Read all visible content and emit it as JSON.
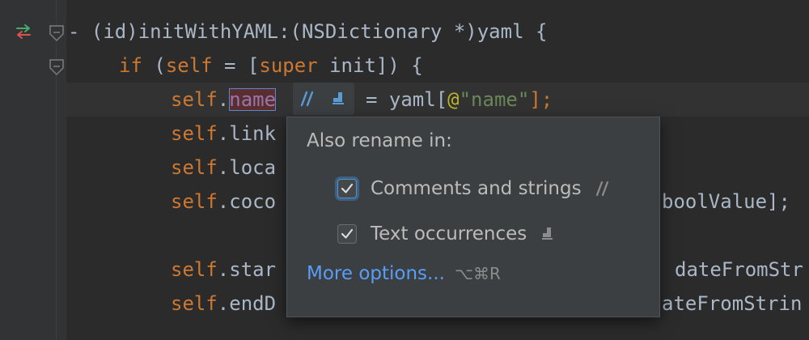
{
  "editor": {
    "lines": [
      {
        "id": "method-signature",
        "tokens": [
          {
            "t": "- (id)initWithYAML:(",
            "c": ""
          },
          {
            "t": "NSDictionary",
            "c": "cls"
          },
          {
            "t": " *)yaml {",
            "c": ""
          }
        ]
      },
      {
        "id": "if-line",
        "tokens": [
          {
            "t": "if",
            "c": "kw"
          },
          {
            "t": " (",
            "c": ""
          },
          {
            "t": "self",
            "c": "kw"
          },
          {
            "t": " = [",
            "c": ""
          },
          {
            "t": "super",
            "c": "kw"
          },
          {
            "t": " init]) {",
            "c": ""
          }
        ]
      },
      {
        "id": "name-line",
        "tokens": [
          {
            "t": "self",
            "c": "kw"
          },
          {
            "t": ".",
            "c": ""
          }
        ],
        "renamed": "name",
        "after": [
          {
            "t": "= yaml[",
            "c": ""
          },
          {
            "t": "@",
            "c": "ann"
          },
          {
            "t": "\"name\"",
            "c": "str"
          },
          {
            "t": "];",
            "c": "kw"
          }
        ]
      },
      {
        "id": "link-line",
        "tokens": [
          {
            "t": "self",
            "c": "kw"
          },
          {
            "t": ".link",
            "c": ""
          }
        ]
      },
      {
        "id": "loca-line",
        "tokens": [
          {
            "t": "self",
            "c": "kw"
          },
          {
            "t": ".loca",
            "c": ""
          }
        ]
      },
      {
        "id": "coco-line",
        "tokens": [
          {
            "t": "self",
            "c": "kw"
          },
          {
            "t": ".coco",
            "c": ""
          }
        ],
        "tail": [
          {
            "t": "boolValue];",
            "c": ""
          }
        ]
      },
      {
        "id": "star-line",
        "tokens": [
          {
            "t": "self",
            "c": "kw"
          },
          {
            "t": ".star",
            "c": ""
          }
        ],
        "tail": [
          {
            "t": "dateFromStr",
            "c": ""
          }
        ]
      },
      {
        "id": "endd-line",
        "tokens": [
          {
            "t": "self",
            "c": "kw"
          },
          {
            "t": ".endD",
            "c": ""
          }
        ],
        "tail": [
          {
            "t": "ateFromStrin",
            "c": ""
          }
        ]
      }
    ]
  },
  "icons": {
    "gutter_arrows": "override-arrows-icon",
    "fold": "fold-marker-icon",
    "comments_strings": "comments-strings-icon",
    "text_occurrences": "text-occurrences-icon",
    "checkmark": "checkmark-icon"
  },
  "popup": {
    "title": "Also rename in:",
    "options": [
      {
        "label": "Comments and strings",
        "checked": true,
        "focused": true
      },
      {
        "label": "Text occurrences",
        "checked": true,
        "focused": false
      }
    ],
    "more_link": "More options...",
    "shortcut": "⌥⌘R"
  },
  "colors": {
    "background": "#2b2b2b",
    "keyword": "#cc7832",
    "string": "#6a8759",
    "link": "#589df6",
    "accent": "#5b88c8"
  }
}
